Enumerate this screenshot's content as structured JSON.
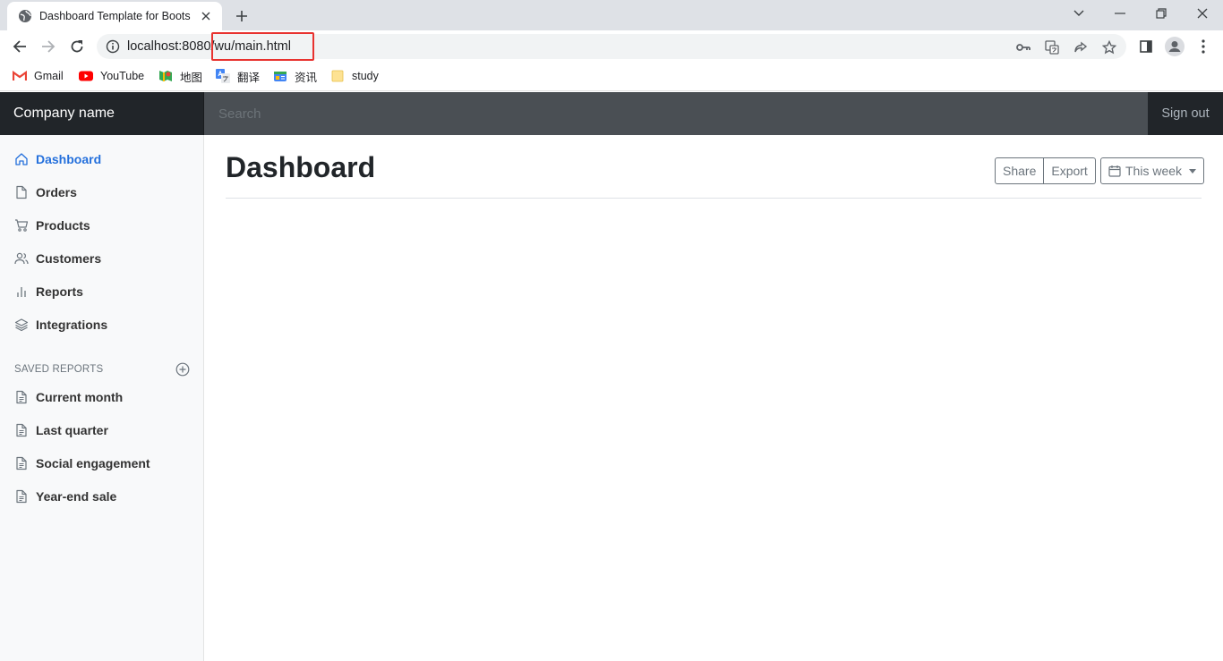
{
  "browser": {
    "tab_title": "Dashboard Template for Boots",
    "url_host": "localhost:8080",
    "url_path": "/wu/main.html",
    "bookmarks": [
      {
        "label": "Gmail",
        "icon": "gmail-icon"
      },
      {
        "label": "YouTube",
        "icon": "youtube-icon"
      },
      {
        "label": "地图",
        "icon": "maps-icon"
      },
      {
        "label": "翻译",
        "icon": "translate-icon"
      },
      {
        "label": "资讯",
        "icon": "news-icon"
      },
      {
        "label": "study",
        "icon": "folder-icon"
      }
    ]
  },
  "header": {
    "brand": "Company name",
    "search_placeholder": "Search",
    "signout": "Sign out"
  },
  "sidebar": {
    "items": [
      {
        "label": "Dashboard",
        "icon": "home-icon",
        "active": true
      },
      {
        "label": "Orders",
        "icon": "file-icon"
      },
      {
        "label": "Products",
        "icon": "cart-icon"
      },
      {
        "label": "Customers",
        "icon": "users-icon"
      },
      {
        "label": "Reports",
        "icon": "bar-chart-icon"
      },
      {
        "label": "Integrations",
        "icon": "layers-icon"
      }
    ],
    "saved_heading": "SAVED REPORTS",
    "saved_items": [
      {
        "label": "Current month",
        "icon": "file-text-icon"
      },
      {
        "label": "Last quarter",
        "icon": "file-text-icon"
      },
      {
        "label": "Social engagement",
        "icon": "file-text-icon"
      },
      {
        "label": "Year-end sale",
        "icon": "file-text-icon"
      }
    ]
  },
  "main": {
    "title": "Dashboard",
    "share_label": "Share",
    "export_label": "Export",
    "range_label": "This week"
  },
  "colors": {
    "active": "#2470dc",
    "navbar": "#212529",
    "search_bg": "#4a4f54"
  }
}
